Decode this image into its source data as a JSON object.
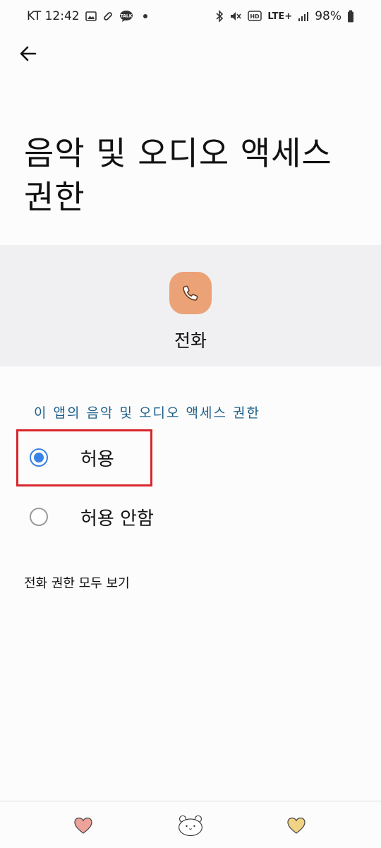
{
  "status_bar": {
    "carrier_time": "KT 12:42",
    "network": "LTE+",
    "battery": "98%",
    "icons_left": [
      "gallery-icon",
      "link-icon",
      "talk-icon",
      "dot-icon"
    ],
    "icons_right": [
      "bluetooth-icon",
      "mute-icon",
      "hd-icon",
      "lte-icon",
      "signal-icon",
      "battery-icon"
    ],
    "talk_label": "TALK",
    "hd_label": "HD"
  },
  "header": {
    "back_icon": "arrow-left-icon",
    "title": "음악 및 오디오 액세스 권한"
  },
  "app": {
    "icon": "phone-icon",
    "icon_color": "#eba276",
    "name": "전화"
  },
  "permission": {
    "section_label": "이 앱의 음악 및 오디오 액세스 권한",
    "options": [
      {
        "label": "허용",
        "selected": true
      },
      {
        "label": "허용 안함",
        "selected": false
      }
    ],
    "view_all": "전화 권한 모두 보기"
  },
  "colors": {
    "accent": "#3b82e6",
    "section_label": "#1d5f8a",
    "highlight": "#d9262c",
    "band": "#f0f0f2"
  },
  "nav": {
    "left_icon": "heart-icon",
    "center_icon": "bear-icon",
    "right_icon": "heart-icon"
  }
}
